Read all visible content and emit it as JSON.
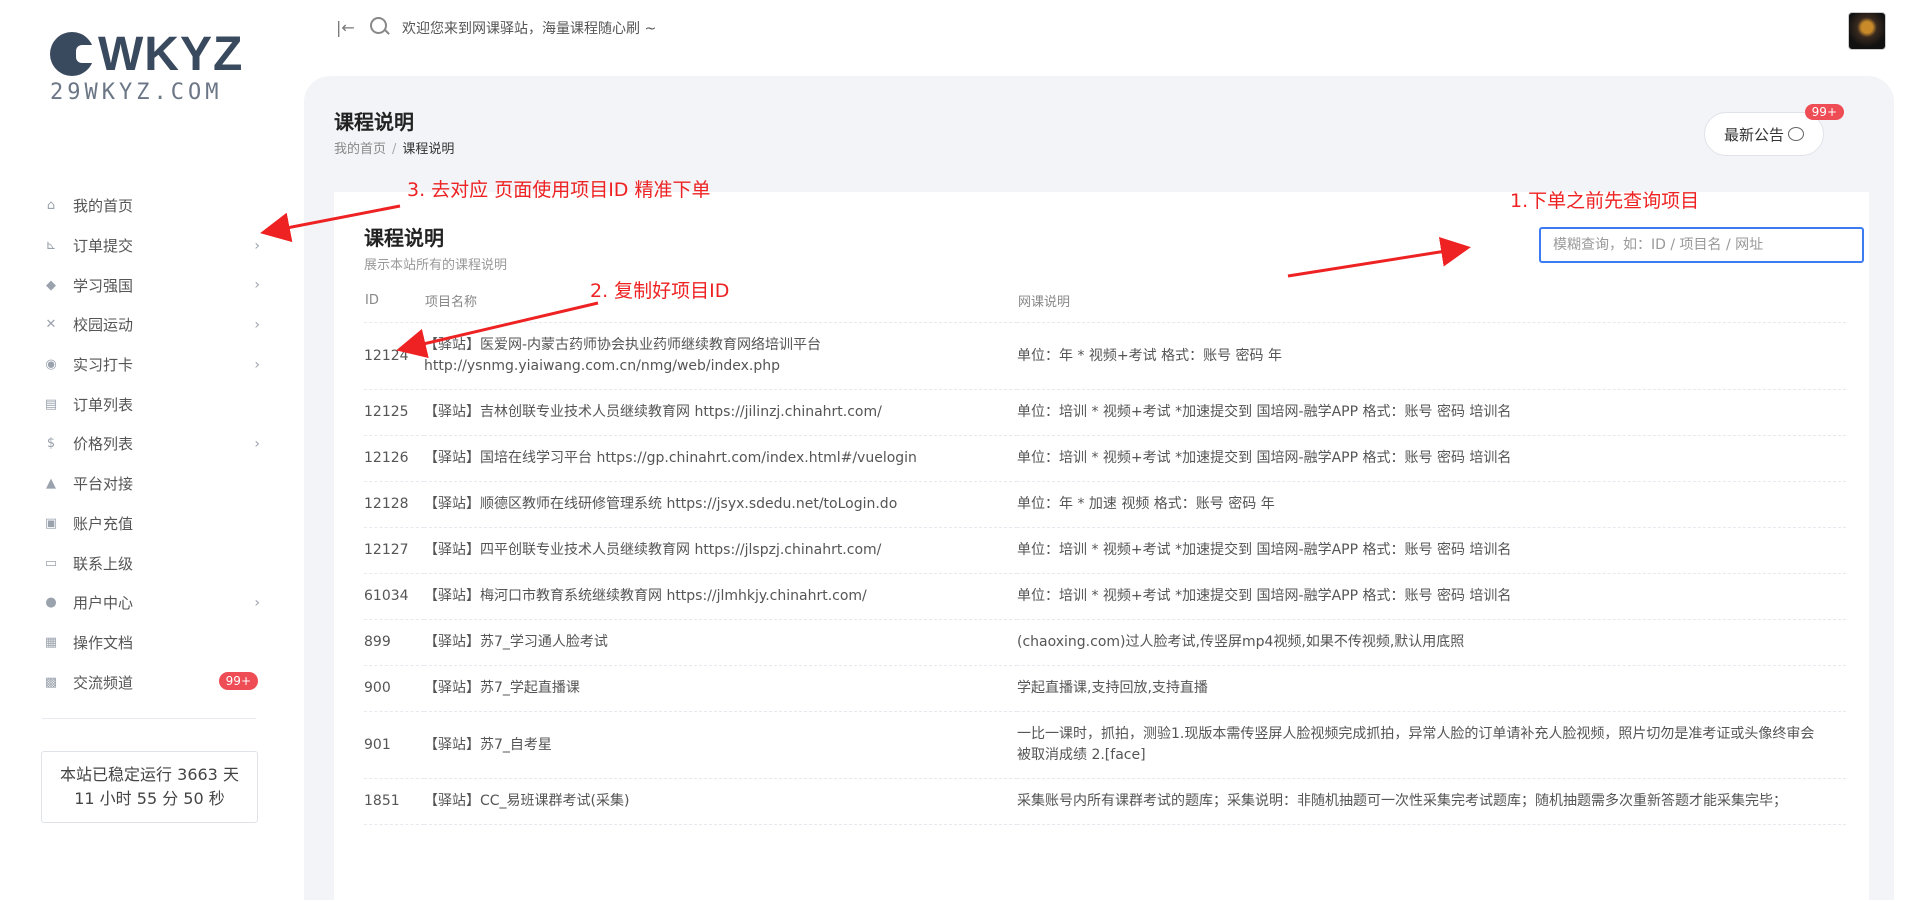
{
  "brand": {
    "logo_main": "WKYZ",
    "logo_sub": "29WKYZ.COM"
  },
  "topbar": {
    "welcome_text": "欢迎您来到网课驿站，海量课程随心刷 ~"
  },
  "sidebar": {
    "items": [
      {
        "label": "我的首页",
        "icon": "home-icon",
        "chevron": false
      },
      {
        "label": "订单提交",
        "icon": "cart-icon",
        "chevron": true
      },
      {
        "label": "学习强国",
        "icon": "graduation-cap-icon",
        "chevron": true
      },
      {
        "label": "校园运动",
        "icon": "run-icon",
        "chevron": true
      },
      {
        "label": "实习打卡",
        "icon": "map-pin-icon",
        "chevron": true
      },
      {
        "label": "订单列表",
        "icon": "list-icon",
        "chevron": false
      },
      {
        "label": "价格列表",
        "icon": "dollar-icon",
        "chevron": true
      },
      {
        "label": "平台对接",
        "icon": "link-icon",
        "chevron": false
      },
      {
        "label": "账户充值",
        "icon": "wallet-icon",
        "chevron": false
      },
      {
        "label": "联系上级",
        "icon": "message-icon",
        "chevron": false
      },
      {
        "label": "用户中心",
        "icon": "user-icon",
        "chevron": true
      },
      {
        "label": "操作文档",
        "icon": "document-icon",
        "chevron": false
      },
      {
        "label": "交流频道",
        "icon": "chat-icon",
        "chevron": false,
        "badge": "99+"
      }
    ],
    "uptime_line1": "本站已稳定运行 3663 天",
    "uptime_line2": "11 小时 55 分 50 秒"
  },
  "page": {
    "title": "课程说明",
    "breadcrumb_home": "我的首页",
    "breadcrumb_current": "课程说明",
    "announce_label": "最新公告",
    "announce_badge": "99+"
  },
  "card": {
    "title": "课程说明",
    "subtitle": "展示本站所有的课程说明",
    "search_placeholder": "模糊查询，如：ID / 项目名 / 网址",
    "headers": {
      "id": "ID",
      "name": "项目名称",
      "desc": "网课说明"
    },
    "rows": [
      {
        "id": "12124",
        "name": "【驿站】医爱网-内蒙古药师协会执业药师继续教育网络培训平台 http://ysnmg.yiaiwang.com.cn/nmg/web/index.php",
        "desc": "单位：年 * 视频+考试 格式：账号 密码 年"
      },
      {
        "id": "12125",
        "name": "【驿站】吉林创联专业技术人员继续教育网 https://jilinzj.chinahrt.com/",
        "desc": "单位：培训 * 视频+考试 *加速提交到 国培网-融学APP 格式：账号 密码 培训名"
      },
      {
        "id": "12126",
        "name": "【驿站】国培在线学习平台 https://gp.chinahrt.com/index.html#/vuelogin",
        "desc": "单位：培训 * 视频+考试 *加速提交到 国培网-融学APP 格式：账号 密码 培训名"
      },
      {
        "id": "12128",
        "name": "【驿站】顺德区教师在线研修管理系统 https://jsyx.sdedu.net/toLogin.do",
        "desc": "单位：年 * 加速 视频 格式：账号 密码 年"
      },
      {
        "id": "12127",
        "name": "【驿站】四平创联专业技术人员继续教育网 https://jlspzj.chinahrt.com/",
        "desc": "单位：培训 * 视频+考试 *加速提交到 国培网-融学APP 格式：账号 密码 培训名"
      },
      {
        "id": "61034",
        "name": "【驿站】梅河口市教育系统继续教育网 https://jlmhkjy.chinahrt.com/",
        "desc": "单位：培训 * 视频+考试 *加速提交到 国培网-融学APP 格式：账号 密码 培训名"
      },
      {
        "id": "899",
        "name": "【驿站】苏7_学习通人脸考试",
        "desc": "(chaoxing.com)过人脸考试,传竖屏mp4视频,如果不传视频,默认用底照"
      },
      {
        "id": "900",
        "name": "【驿站】苏7_学起直播课",
        "desc": "学起直播课,支持回放,支持直播"
      },
      {
        "id": "901",
        "name": "【驿站】苏7_自考星",
        "desc": "一比一课时，抓拍，测验1.现版本需传竖屏人脸视频完成抓拍，异常人脸的订单请补充人脸视频，照片切勿是准考证或头像终审会被取消成绩 2.[face]"
      },
      {
        "id": "1851",
        "name": "【驿站】CC_易班课群考试(采集)",
        "desc": "采集账号内所有课群考试的题库；采集说明：非随机抽题可一次性采集完考试题库；随机抽题需多次重新答题才能采集完毕；"
      }
    ]
  },
  "annotations": {
    "step1": "1.下单之前先查询项目",
    "step2": "2. 复制好项目ID",
    "step3": "3. 去对应 页面使用项目ID 精准下单"
  },
  "colors": {
    "accent": "#3d7cf0",
    "badge": "#ee4d55",
    "annotation": "#ee2222",
    "content_bg": "#f2f4f7"
  }
}
